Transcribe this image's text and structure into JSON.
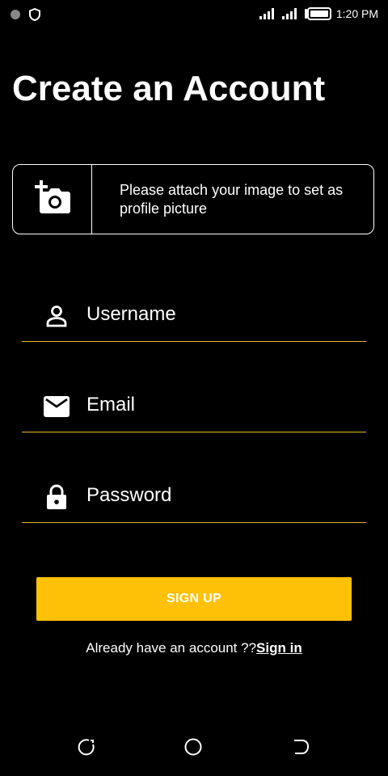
{
  "status_bar": {
    "time": "1:20 PM",
    "icons": [
      "notification-dot-icon",
      "shield-icon",
      "signal-icon",
      "signal-icon",
      "battery-icon"
    ]
  },
  "title": "Create an Account",
  "attach": {
    "icon": "add-photo-icon",
    "text": "Please attach your image to set as profile picture"
  },
  "fields": {
    "username": {
      "icon": "person-icon",
      "label": "Username"
    },
    "email": {
      "icon": "mail-icon",
      "label": "Email"
    },
    "password": {
      "icon": "lock-icon",
      "label": "Password"
    }
  },
  "signup_label": "SIGN UP",
  "signin": {
    "prompt": "Already have an account ??",
    "link": "Sign in"
  },
  "nav": [
    "back-icon",
    "home-icon",
    "recents-icon"
  ],
  "colors": {
    "accent": "#ffc107",
    "underline": "#e8b92a",
    "background": "#000000",
    "text": "#ffffff"
  }
}
